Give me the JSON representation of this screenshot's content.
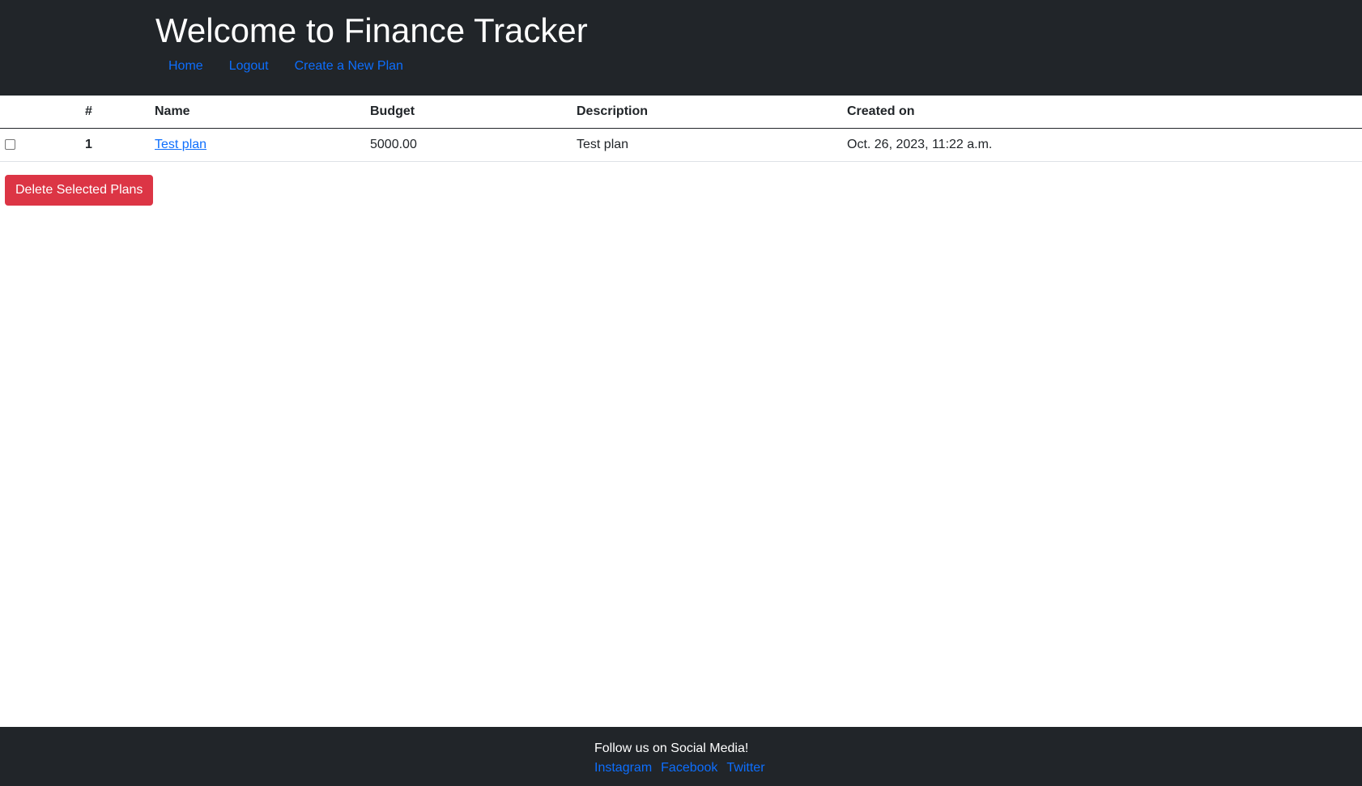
{
  "header": {
    "title": "Welcome to Finance Tracker",
    "nav": [
      {
        "label": "Home"
      },
      {
        "label": "Logout"
      },
      {
        "label": "Create a New Plan"
      }
    ]
  },
  "table": {
    "columns": [
      "",
      "#",
      "Name",
      "Budget",
      "Description",
      "Created on"
    ],
    "rows": [
      {
        "checked": false,
        "number": "1",
        "name": "Test plan",
        "budget": "5000.00",
        "description": "Test plan",
        "created_on": "Oct. 26, 2023, 11:22 a.m."
      }
    ]
  },
  "actions": {
    "delete_label": "Delete Selected Plans"
  },
  "footer": {
    "text": "Follow us on Social Media!",
    "links": [
      {
        "label": "Instagram"
      },
      {
        "label": "Facebook"
      },
      {
        "label": "Twitter"
      }
    ]
  },
  "colors": {
    "header_bg": "#212529",
    "link": "#0d6efd",
    "danger": "#dc3545"
  }
}
